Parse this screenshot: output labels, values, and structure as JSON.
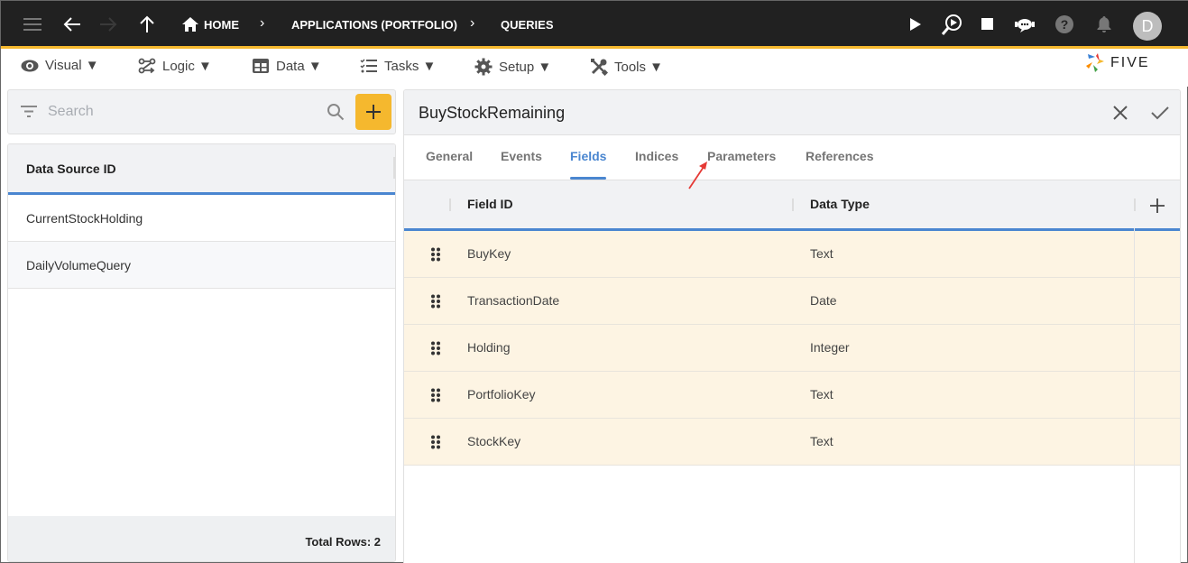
{
  "topbar": {
    "icons": [
      "menu-icon",
      "back-arrow-icon",
      "forward-arrow-icon",
      "up-arrow-icon"
    ],
    "breadcrumb": [
      {
        "label": "HOME",
        "icon": "home-icon"
      },
      {
        "label": "APPLICATIONS (PORTFOLIO)"
      },
      {
        "label": "QUERIES"
      }
    ],
    "right_icons": [
      "play-icon",
      "search-play-icon",
      "stop-icon",
      "chat-bot-icon",
      "help-icon",
      "bell-icon"
    ],
    "avatar_initial": "D"
  },
  "menubar": {
    "items": [
      {
        "label": "Visual ▼",
        "icon": "eye-icon"
      },
      {
        "label": "Logic ▼",
        "icon": "logic-flow-icon"
      },
      {
        "label": "Data ▼",
        "icon": "table-icon"
      },
      {
        "label": "Tasks ▼",
        "icon": "checklist-icon"
      },
      {
        "label": "Setup ▼",
        "icon": "gear-icon"
      },
      {
        "label": "Tools ▼",
        "icon": "tools-icon"
      }
    ],
    "logo_text": "FIVE"
  },
  "left_panel": {
    "search_placeholder": "Search",
    "search_value": "",
    "column_header": "Data Source ID",
    "rows": [
      "CurrentStockHolding",
      "DailyVolumeQuery"
    ],
    "footer": "Total Rows: 2"
  },
  "right_panel": {
    "title": "BuyStockRemaining",
    "tabs": [
      "General",
      "Events",
      "Fields",
      "Indices",
      "Parameters",
      "References"
    ],
    "active_tab": "Fields",
    "grid": {
      "columns": [
        "Field ID",
        "Data Type"
      ],
      "rows": [
        {
          "field_id": "BuyKey",
          "data_type": "Text"
        },
        {
          "field_id": "TransactionDate",
          "data_type": "Date"
        },
        {
          "field_id": "Holding",
          "data_type": "Integer"
        },
        {
          "field_id": "PortfolioKey",
          "data_type": "Text"
        },
        {
          "field_id": "StockKey",
          "data_type": "Text"
        }
      ]
    }
  },
  "colors": {
    "accent_yellow": "#f5b82e",
    "accent_blue": "#4a86d0",
    "row_highlight": "#fdf4e3",
    "annotation_arrow": "#e53935"
  }
}
